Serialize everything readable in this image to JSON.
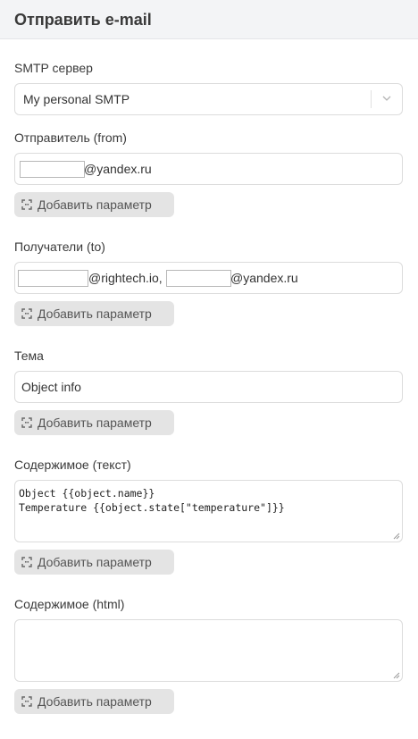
{
  "header": {
    "title": "Отправить e-mail"
  },
  "smtp": {
    "label": "SMTP сервер",
    "value": "My personal SMTP"
  },
  "from": {
    "label": "Отправитель (from)",
    "suffix": "@yandex.ru"
  },
  "to": {
    "label": "Получатели (to)",
    "suffix_1": "@rightech.io,",
    "suffix_2": "@yandex.ru"
  },
  "subject": {
    "label": "Тема",
    "value": "Object info"
  },
  "body_text": {
    "label": "Содержимое (текст)",
    "line_1": "Object {{object.name}}",
    "line_2": "Temperature {{object.state[\"temperature\"]}}"
  },
  "body_html": {
    "label": "Содержимое (html)",
    "value": ""
  },
  "add_param_label": "Добавить параметр",
  "icons": {
    "chevron": "chevron-down-icon",
    "param": "variable-bracket-icon"
  }
}
